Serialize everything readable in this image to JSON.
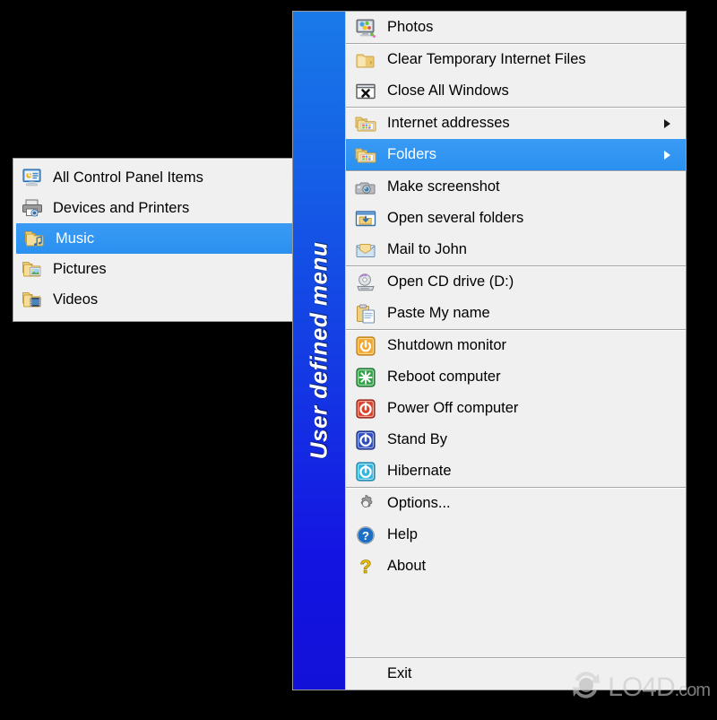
{
  "app": {
    "gutter_label": "User defined menu"
  },
  "main_menu": {
    "groups": [
      {
        "items": [
          {
            "label": "Photos",
            "icon": "photos-monitor-icon",
            "submenu": false,
            "selected": false
          }
        ]
      },
      {
        "items": [
          {
            "label": "Clear Temporary Internet Files",
            "icon": "folder-plain-icon",
            "submenu": false,
            "selected": false
          },
          {
            "label": "Close All Windows",
            "icon": "close-window-icon",
            "submenu": false,
            "selected": false
          }
        ]
      },
      {
        "items": [
          {
            "label": "Internet addresses",
            "icon": "folder-tiles-icon",
            "submenu": true,
            "selected": false
          },
          {
            "label": "Folders",
            "icon": "folder-tiles-icon",
            "submenu": true,
            "selected": true
          }
        ]
      },
      {
        "items": [
          {
            "label": "Make screenshot",
            "icon": "camera-icon",
            "submenu": false,
            "selected": false
          },
          {
            "label": "Open several folders",
            "icon": "open-folders-window-icon",
            "submenu": false,
            "selected": false
          },
          {
            "label": "Mail to John",
            "icon": "mail-envelope-icon",
            "submenu": false,
            "selected": false
          }
        ]
      },
      {
        "items": [
          {
            "label": "Open CD drive (D:)",
            "icon": "cd-drive-icon",
            "submenu": false,
            "selected": false
          },
          {
            "label": "Paste My name",
            "icon": "clipboard-paste-icon",
            "submenu": false,
            "selected": false
          }
        ]
      },
      {
        "items": [
          {
            "label": "Shutdown monitor",
            "icon": "power-orange-icon",
            "submenu": false,
            "selected": false
          },
          {
            "label": "Reboot computer",
            "icon": "reboot-green-icon",
            "submenu": false,
            "selected": false
          },
          {
            "label": "Power Off computer",
            "icon": "power-red-icon",
            "submenu": false,
            "selected": false
          },
          {
            "label": "Stand By",
            "icon": "standby-blue-icon",
            "submenu": false,
            "selected": false
          },
          {
            "label": "Hibernate",
            "icon": "hibernate-cyan-icon",
            "submenu": false,
            "selected": false
          }
        ]
      },
      {
        "items": [
          {
            "label": "Options...",
            "icon": "gear-icon",
            "submenu": false,
            "selected": false
          },
          {
            "label": "Help",
            "icon": "help-circle-icon",
            "submenu": false,
            "selected": false
          },
          {
            "label": "About",
            "icon": "question-mark-icon",
            "submenu": false,
            "selected": false
          }
        ]
      },
      {
        "items": [
          {
            "label": "Exit",
            "icon": "none",
            "submenu": false,
            "selected": false
          }
        ]
      }
    ]
  },
  "submenu": {
    "items": [
      {
        "label": "All Control Panel Items",
        "icon": "control-panel-icon",
        "selected": false
      },
      {
        "label": "Devices and Printers",
        "icon": "printer-icon",
        "selected": false
      },
      {
        "label": "Music",
        "icon": "folder-music-icon",
        "selected": true
      },
      {
        "label": "Pictures",
        "icon": "folder-pictures-icon",
        "selected": false
      },
      {
        "label": "Videos",
        "icon": "folder-videos-icon",
        "selected": false
      }
    ]
  },
  "watermark": {
    "text": "LO4D",
    "suffix": ".com",
    "logo_icon": "refresh-circle-logo-icon"
  },
  "colors": {
    "highlight": "#2a90f0",
    "gutter_top": "#1a7ae8",
    "gutter_bottom": "#1111d8",
    "menu_bg": "#f0f0f0",
    "separator": "#a6a6a6",
    "text": "#000000",
    "selected_text": "#ffffff"
  }
}
